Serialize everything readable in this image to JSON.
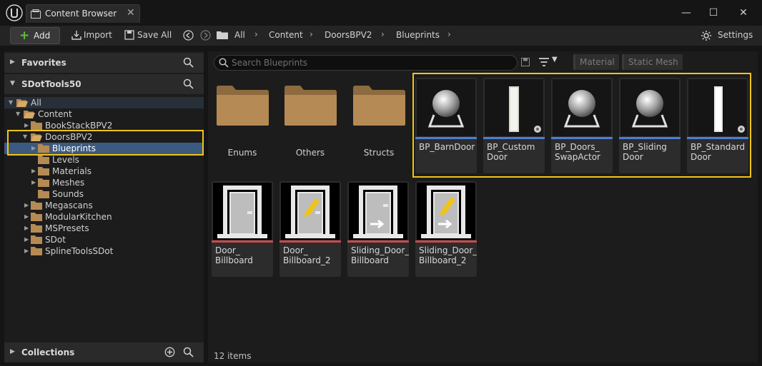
{
  "window": {
    "tab_label": "Content Browser",
    "close_glyph": "✕",
    "minimize_glyph": "—",
    "maximize_glyph": "☐",
    "window_close_glyph": "✕"
  },
  "toolbar": {
    "add_label": "Add",
    "import_label": "Import",
    "save_all_label": "Save All",
    "settings_label": "Settings",
    "breadcrumbs": [
      "All",
      "Content",
      "DoorsBPV2",
      "Blueprints"
    ]
  },
  "left_panel": {
    "favorites_label": "Favorites",
    "project_label": "SDotTools50",
    "collections_label": "Collections",
    "tree": [
      {
        "label": "All",
        "depth": 0,
        "expanded": true
      },
      {
        "label": "Content",
        "depth": 1,
        "expanded": true
      },
      {
        "label": "BookStackBPV2",
        "depth": 2,
        "expanded": false
      },
      {
        "label": "DoorsBPV2",
        "depth": 2,
        "expanded": true
      },
      {
        "label": "Blueprints",
        "depth": 3,
        "expanded": false,
        "selected": true
      },
      {
        "label": "Levels",
        "depth": 3,
        "expanded": false
      },
      {
        "label": "Materials",
        "depth": 3,
        "expanded": false
      },
      {
        "label": "Meshes",
        "depth": 3,
        "expanded": false
      },
      {
        "label": "Sounds",
        "depth": 3,
        "expanded": false
      },
      {
        "label": "Megascans",
        "depth": 2,
        "expanded": false
      },
      {
        "label": "ModularKitchen",
        "depth": 2,
        "expanded": false
      },
      {
        "label": "MSPresets",
        "depth": 2,
        "expanded": false
      },
      {
        "label": "SDot",
        "depth": 2,
        "expanded": false
      },
      {
        "label": "SplineToolsSDot",
        "depth": 2,
        "expanded": false
      }
    ]
  },
  "right_panel": {
    "search_placeholder": "Search Blueprints",
    "filters": [
      "Material",
      "Static Mesh"
    ],
    "folders": [
      "Enums",
      "Others",
      "Structs"
    ],
    "blueprints": [
      {
        "label": "BP_BarnDoor",
        "thumb": "sphere"
      },
      {
        "label": "BP_Custom Door",
        "thumb": "door"
      },
      {
        "label": "BP_Doors_ SwapActor",
        "thumb": "sphere"
      },
      {
        "label": "BP_Sliding Door",
        "thumb": "sphere"
      },
      {
        "label": "BP_Standard Door",
        "thumb": "door"
      }
    ],
    "billboards": [
      {
        "label": "Door_ Billboard",
        "thumb": "door-icon"
      },
      {
        "label": "Door_ Billboard_2",
        "thumb": "door-pencil"
      },
      {
        "label": "Sliding_Door_ Billboard",
        "thumb": "door-arrow"
      },
      {
        "label": "Sliding_Door_ Billboard_2",
        "thumb": "door-arrow-pencil"
      }
    ],
    "items_count": "12 items"
  },
  "colors": {
    "accent_blue": "#4a7fd4",
    "billboard_red": "#c84a4a",
    "highlight_yellow": "#f0c419",
    "selection": "#3c5a80",
    "folder": "#b68a54"
  }
}
